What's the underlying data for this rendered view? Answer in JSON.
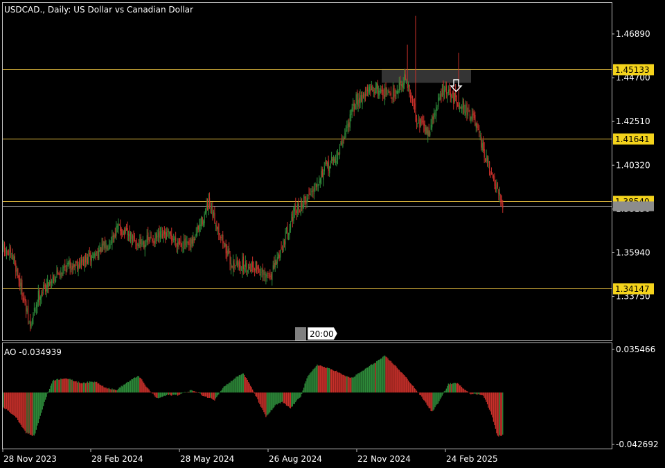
{
  "window": {
    "title": "USDCAD., Daily:  US Dollar vs Canadian Dollar",
    "indicator_label": "AO -0.034939",
    "cursor_time": "20:00"
  },
  "colors": {
    "background": "#000000",
    "frame": "#c0c0c0",
    "bull": "#2e8b3a",
    "bear": "#c8302a",
    "level_line": "#e8c040",
    "level_label_bg": "#f4d31c",
    "bid_line": "#a0a0a0",
    "zone": "#3a3a3a"
  },
  "chart_data": [
    {
      "type": "candlestick",
      "symbol": "USDCAD.",
      "timeframe": "Daily",
      "title": "USDCAD., Daily:  US Dollar vs Canadian Dollar",
      "ylim": [
        1.3155,
        1.4845
      ],
      "y_ticks": [
        "1.46890",
        "1.44700",
        "1.42510",
        "1.40320",
        "1.38130",
        "1.35940",
        "1.33750"
      ],
      "x_ticks": [
        "28 Nov 2023",
        "28 Feb 2024",
        "28 May 2024",
        "26 Aug 2024",
        "22 Nov 2024",
        "24 Feb 2025"
      ],
      "horizontal_levels": [
        "1.45133",
        "1.41641",
        "1.38540",
        "1.34147"
      ],
      "current_price": 1.3827,
      "anchors": [
        {
          "i": 0,
          "p": 1.361
        },
        {
          "i": 10,
          "p": 1.356
        },
        {
          "i": 18,
          "p": 1.34
        },
        {
          "i": 26,
          "p": 1.322
        },
        {
          "i": 34,
          "p": 1.338
        },
        {
          "i": 48,
          "p": 1.347
        },
        {
          "i": 62,
          "p": 1.353
        },
        {
          "i": 80,
          "p": 1.355
        },
        {
          "i": 100,
          "p": 1.363
        },
        {
          "i": 112,
          "p": 1.372
        },
        {
          "i": 130,
          "p": 1.364
        },
        {
          "i": 160,
          "p": 1.368
        },
        {
          "i": 182,
          "p": 1.362
        },
        {
          "i": 200,
          "p": 1.383
        },
        {
          "i": 210,
          "p": 1.371
        },
        {
          "i": 222,
          "p": 1.354
        },
        {
          "i": 234,
          "p": 1.353
        },
        {
          "i": 246,
          "p": 1.353
        },
        {
          "i": 254,
          "p": 1.347
        },
        {
          "i": 262,
          "p": 1.349
        },
        {
          "i": 282,
          "p": 1.378
        },
        {
          "i": 296,
          "p": 1.387
        },
        {
          "i": 310,
          "p": 1.399
        },
        {
          "i": 326,
          "p": 1.408
        },
        {
          "i": 344,
          "p": 1.436
        },
        {
          "i": 362,
          "p": 1.442
        },
        {
          "i": 378,
          "p": 1.438
        },
        {
          "i": 392,
          "p": 1.447
        },
        {
          "i": 402,
          "p": 1.428
        },
        {
          "i": 414,
          "p": 1.419
        },
        {
          "i": 428,
          "p": 1.441
        },
        {
          "i": 444,
          "p": 1.435
        },
        {
          "i": 458,
          "p": 1.427
        },
        {
          "i": 468,
          "p": 1.41
        },
        {
          "i": 478,
          "p": 1.395
        },
        {
          "i": 487,
          "p": 1.3827
        }
      ]
    },
    {
      "type": "bar",
      "indicator": "Awesome Oscillator",
      "label": "AO -0.034939",
      "ylim": [
        -0.042692,
        0.035466
      ],
      "y_ticks": [
        "0.035466",
        "-0.042692"
      ],
      "last_value": -0.034939,
      "anchors": [
        {
          "i": 0,
          "v": -0.012
        },
        {
          "i": 12,
          "v": -0.02
        },
        {
          "i": 22,
          "v": -0.033
        },
        {
          "i": 30,
          "v": -0.036
        },
        {
          "i": 40,
          "v": -0.008
        },
        {
          "i": 48,
          "v": 0.01
        },
        {
          "i": 60,
          "v": 0.012
        },
        {
          "i": 75,
          "v": 0.008
        },
        {
          "i": 90,
          "v": 0.009
        },
        {
          "i": 100,
          "v": 0.004
        },
        {
          "i": 110,
          "v": 0.002
        },
        {
          "i": 120,
          "v": 0.008
        },
        {
          "i": 132,
          "v": 0.014
        },
        {
          "i": 140,
          "v": 0.004
        },
        {
          "i": 150,
          "v": -0.005
        },
        {
          "i": 160,
          "v": -0.002
        },
        {
          "i": 170,
          "v": -0.002
        },
        {
          "i": 184,
          "v": 0.002
        },
        {
          "i": 196,
          "v": -0.003
        },
        {
          "i": 206,
          "v": -0.006
        },
        {
          "i": 214,
          "v": 0.004
        },
        {
          "i": 226,
          "v": 0.012
        },
        {
          "i": 234,
          "v": 0.016
        },
        {
          "i": 244,
          "v": 0.001
        },
        {
          "i": 256,
          "v": -0.02
        },
        {
          "i": 266,
          "v": -0.01
        },
        {
          "i": 272,
          "v": -0.008
        },
        {
          "i": 280,
          "v": -0.013
        },
        {
          "i": 290,
          "v": -0.003
        },
        {
          "i": 296,
          "v": 0.012
        },
        {
          "i": 306,
          "v": 0.023
        },
        {
          "i": 316,
          "v": 0.02
        },
        {
          "i": 324,
          "v": 0.018
        },
        {
          "i": 332,
          "v": 0.014
        },
        {
          "i": 340,
          "v": 0.012
        },
        {
          "i": 354,
          "v": 0.02
        },
        {
          "i": 372,
          "v": 0.03
        },
        {
          "i": 380,
          "v": 0.024
        },
        {
          "i": 390,
          "v": 0.015
        },
        {
          "i": 400,
          "v": 0.005
        },
        {
          "i": 410,
          "v": -0.006
        },
        {
          "i": 418,
          "v": -0.016
        },
        {
          "i": 426,
          "v": -0.006
        },
        {
          "i": 434,
          "v": 0.007
        },
        {
          "i": 442,
          "v": 0.008
        },
        {
          "i": 448,
          "v": 0.004
        },
        {
          "i": 456,
          "v": -0.001
        },
        {
          "i": 468,
          "v": -0.002
        },
        {
          "i": 476,
          "v": -0.018
        },
        {
          "i": 482,
          "v": -0.036
        },
        {
          "i": 487,
          "v": -0.034939
        }
      ]
    }
  ]
}
